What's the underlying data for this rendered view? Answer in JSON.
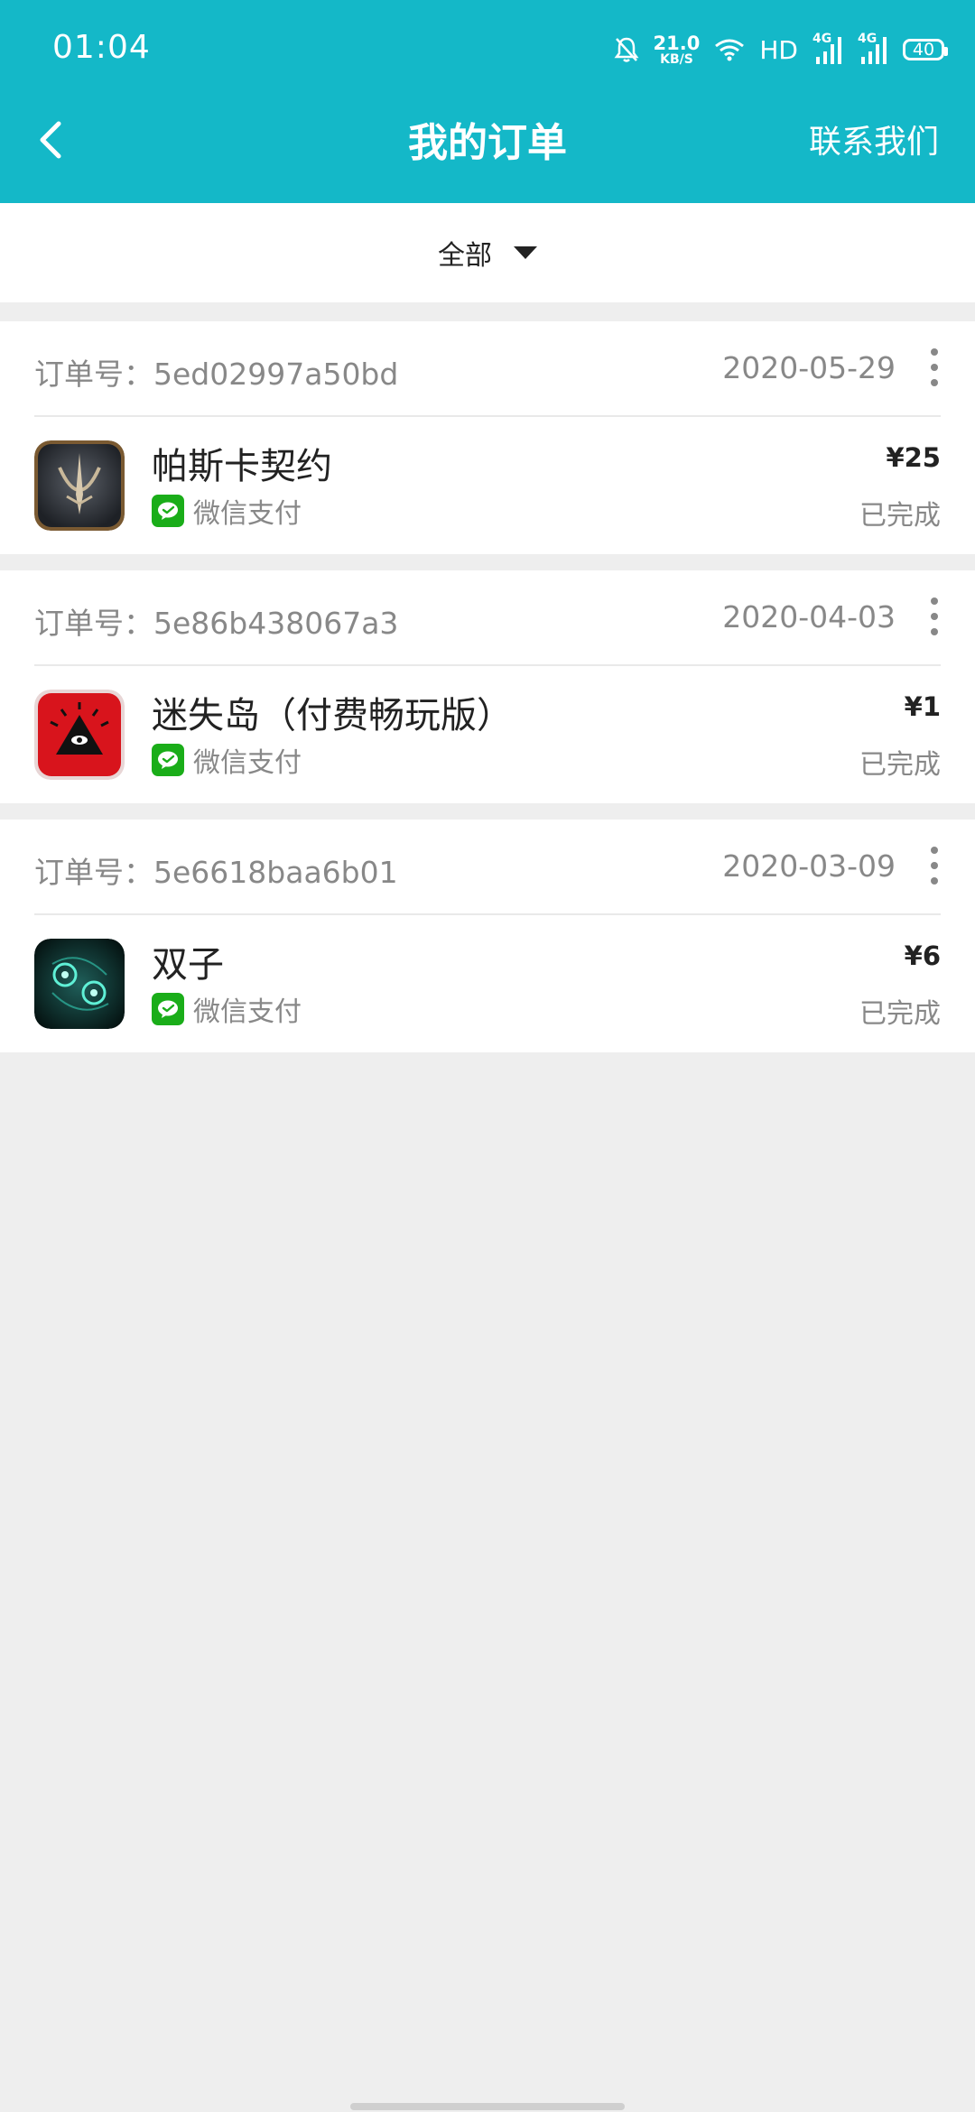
{
  "status_bar": {
    "time": "01:04",
    "net_speed_value": "21.0",
    "net_speed_unit": "KB/S",
    "hd_label": "HD",
    "signal_label": "4G",
    "battery": "40"
  },
  "header": {
    "title": "我的订单",
    "contact": "联系我们",
    "background_color": "#14b8c8"
  },
  "filter": {
    "label": "全部"
  },
  "orders": [
    {
      "order_no": "订单号：5ed02997a50bd",
      "date": "2020-05-29",
      "app_name": "帕斯卡契约",
      "payment": "微信支付",
      "price": "¥25",
      "status": "已完成"
    },
    {
      "order_no": "订单号：5e86b438067a3",
      "date": "2020-04-03",
      "app_name": "迷失岛（付费畅玩版）",
      "payment": "微信支付",
      "price": "¥1",
      "status": "已完成"
    },
    {
      "order_no": "订单号：5e6618baa6b01",
      "date": "2020-03-09",
      "app_name": "双子",
      "payment": "微信支付",
      "price": "¥6",
      "status": "已完成"
    }
  ],
  "colors": {
    "wechat_green": "#1aad19",
    "text_secondary": "#888888"
  }
}
